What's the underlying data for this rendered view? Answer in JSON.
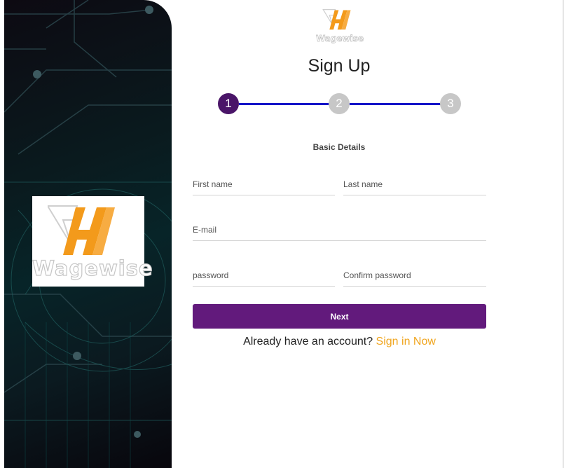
{
  "brand": {
    "name": "Wagewise",
    "colors": {
      "orange": "#f39a1b",
      "purple": "#621a7c",
      "link": "#f0a51e",
      "step_line": "#1515c8"
    }
  },
  "page": {
    "title": "Sign Up"
  },
  "stepper": {
    "steps": [
      {
        "label": "1",
        "state": "active"
      },
      {
        "label": "2",
        "state": "inactive"
      },
      {
        "label": "3",
        "state": "inactive"
      }
    ]
  },
  "form": {
    "section_label": "Basic Details",
    "first_name": {
      "placeholder": "First name",
      "value": ""
    },
    "last_name": {
      "placeholder": "Last name",
      "value": ""
    },
    "email": {
      "placeholder": "E-mail",
      "value": ""
    },
    "password": {
      "placeholder": "password",
      "value": ""
    },
    "confirm_password": {
      "placeholder": "Confirm password",
      "value": ""
    },
    "next_label": "Next"
  },
  "footer": {
    "prompt": "Already have an account?",
    "link_label": "Sign in Now"
  }
}
